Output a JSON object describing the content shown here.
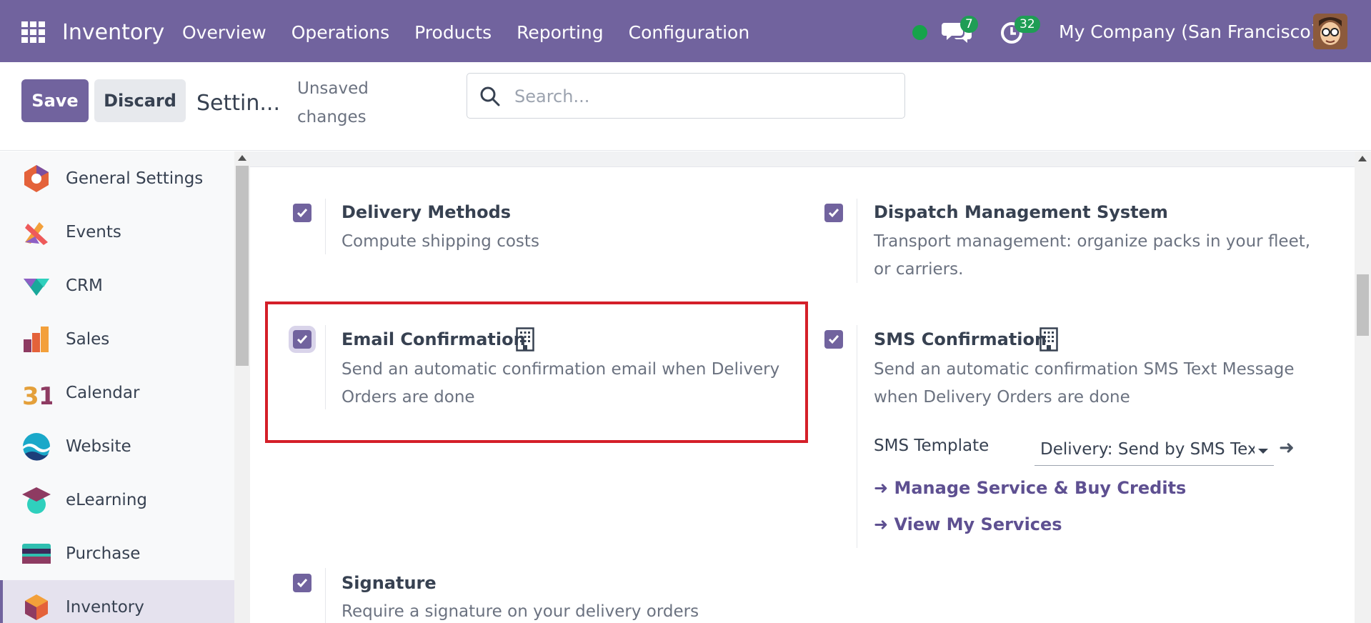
{
  "navbar": {
    "brand": "Inventory",
    "menu": [
      "Overview",
      "Operations",
      "Products",
      "Reporting",
      "Configuration"
    ],
    "messages_count": "7",
    "activities_count": "32",
    "company": "My Company (San Francisco)"
  },
  "control": {
    "save_label": "Save",
    "discard_label": "Discard",
    "breadcrumb": "Settin...",
    "unsaved_line1": "Unsaved",
    "unsaved_line2": "changes",
    "search_placeholder": "Search..."
  },
  "sidebar": {
    "items": [
      {
        "label": "General Settings",
        "icon": "general-settings-icon"
      },
      {
        "label": "Events",
        "icon": "events-icon"
      },
      {
        "label": "CRM",
        "icon": "crm-icon"
      },
      {
        "label": "Sales",
        "icon": "sales-icon"
      },
      {
        "label": "Calendar",
        "icon": "calendar-icon"
      },
      {
        "label": "Website",
        "icon": "website-icon"
      },
      {
        "label": "eLearning",
        "icon": "elearning-icon"
      },
      {
        "label": "Purchase",
        "icon": "purchase-icon"
      },
      {
        "label": "Inventory",
        "icon": "inventory-icon",
        "active": true
      }
    ]
  },
  "settings": {
    "delivery_methods": {
      "title": "Delivery Methods",
      "desc": "Compute shipping costs",
      "checked": true
    },
    "dispatch": {
      "title": "Dispatch Management System",
      "desc_line1": "Transport management: organize packs in your fleet,",
      "desc_line2": "or carriers.",
      "checked": true
    },
    "email_confirmation": {
      "title": "Email Confirmation",
      "desc_line1": "Send an automatic confirmation email when Delivery",
      "desc_line2": "Orders are done",
      "checked": true
    },
    "sms_confirmation": {
      "title": "SMS Confirmation",
      "desc_line1": "Send an automatic confirmation SMS Text Message",
      "desc_line2": "when Delivery Orders are done",
      "checked": true,
      "template_label": "SMS Template",
      "template_value": "Delivery: Send by SMS Text Message",
      "link_credits": "Manage Service & Buy Credits",
      "link_services": "View My Services"
    },
    "signature": {
      "title": "Signature",
      "desc": "Require a signature on your delivery orders",
      "checked": true
    }
  },
  "colors": {
    "navbar": "#71639e",
    "highlight": "#d41f29",
    "badge": "#1f9d55"
  }
}
